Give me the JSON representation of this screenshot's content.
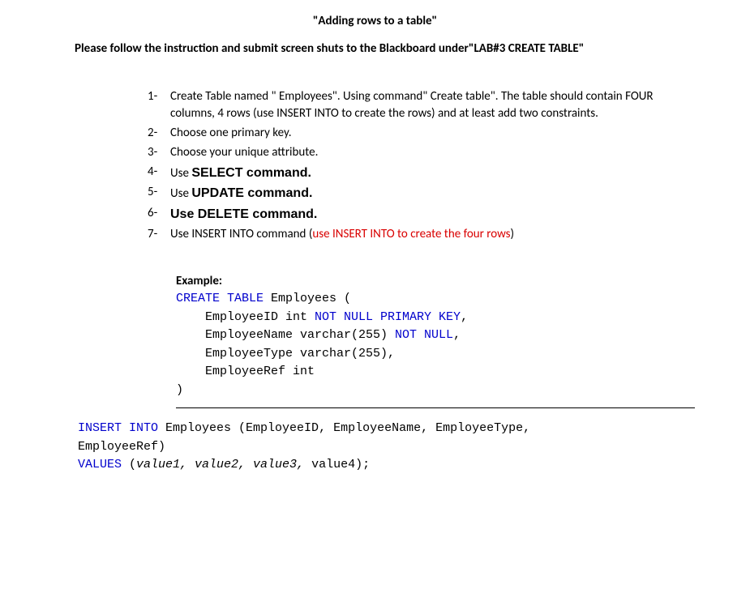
{
  "title": "\"Adding rows to a table\"",
  "intro": "Please follow the instruction and submit screen shuts to the Blackboard under\"LAB#3 CREATE TABLE\"",
  "steps": {
    "s1": {
      "num": "1-",
      "text": "Create Table named \" Employees\". Using command\" Create table\". The table should contain FOUR columns, 4 rows (use INSERT INTO to create the rows) and at least add two constraints."
    },
    "s2": {
      "num": "2-",
      "text": "Choose one primary key."
    },
    "s3": {
      "num": "3-",
      "text": "Choose your unique attribute."
    },
    "s4": {
      "num": "4-",
      "prefix": "Use ",
      "cmd": "SELECT command."
    },
    "s5": {
      "num": "5-",
      "prefix": "Use ",
      "cmd": "UPDATE command."
    },
    "s6": {
      "num": "6-",
      "cmd": "Use DELETE command."
    },
    "s7": {
      "num": "7-",
      "prefix": "Use INSERT INTO command (",
      "red": "use INSERT INTO to create the four rows",
      "suffix": ")"
    }
  },
  "example": {
    "label": "Example:",
    "l1a": "CREATE TABLE",
    "l1b": " Employees (",
    "l2a": "    EmployeeID int ",
    "l2b": "NOT NULL PRIMARY KEY",
    "l2c": ",",
    "l3a": "    EmployeeName varchar(255) ",
    "l3b": "NOT NULL",
    "l3c": ",",
    "l4": "    EmployeeType varchar(255),",
    "l5": "    EmployeeRef int",
    "l6": ")"
  },
  "insert": {
    "l1a": " INSERT INTO",
    "l1b": " Employees (EmployeeID, EmployeeName, EmployeeType,",
    "l2": "EmployeeRef)",
    "l3a": "VALUES",
    "l3b": " (",
    "l3c": "value1, value2, value3,",
    "l3d": " value4);"
  }
}
